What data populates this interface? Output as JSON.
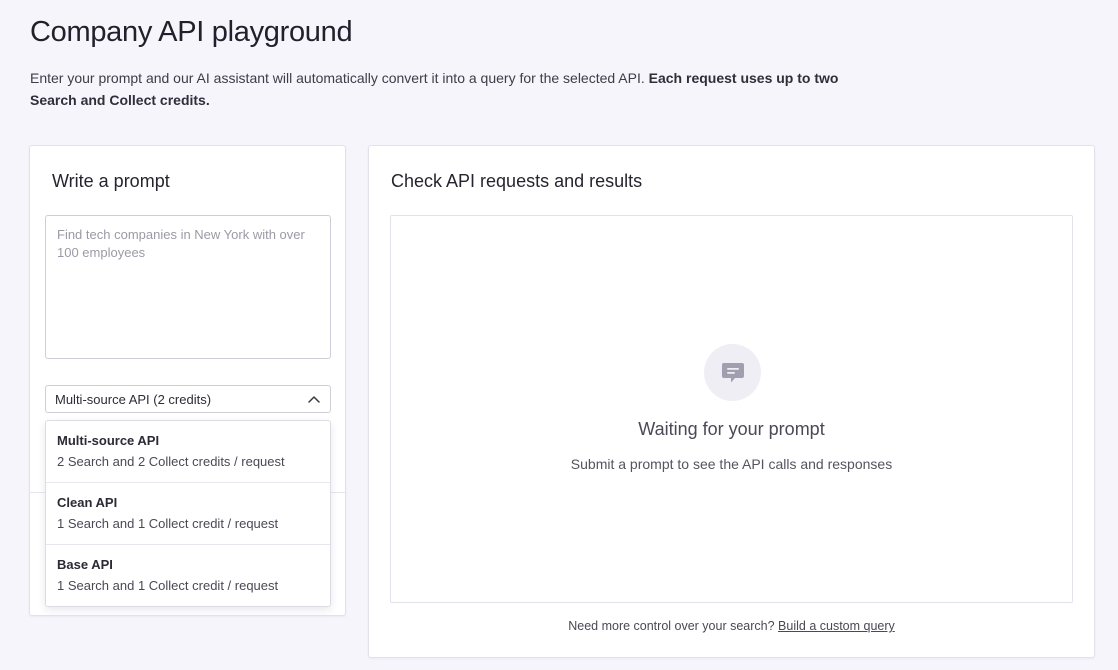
{
  "header": {
    "title": "Company API playground",
    "description": "Enter your prompt and our AI assistant will automatically convert it into a query for the selected API. ",
    "description_bold": "Each request uses up to two Search and Collect credits."
  },
  "prompt_panel": {
    "title": "Write a prompt",
    "input_placeholder": "Find tech companies in New York with over 100 employees",
    "select": {
      "selected": "Multi-source API (2 credits)",
      "options": [
        {
          "title": "Multi-source API",
          "subtitle": "2 Search and 2 Collect credits / request"
        },
        {
          "title": "Clean API",
          "subtitle": "1 Search and 1 Collect credit / request"
        },
        {
          "title": "Base API",
          "subtitle": "1 Search and 1 Collect credit / request"
        }
      ]
    }
  },
  "results_panel": {
    "title": "Check API requests and results",
    "empty_icon": "chat-bubble-icon",
    "empty_title": "Waiting for your prompt",
    "empty_subtitle": "Submit a prompt to see the API calls and responses",
    "footer_text": "Need more control over your search? ",
    "footer_link": "Build a custom query"
  },
  "colors": {
    "background": "#f6f5fc",
    "card": "#ffffff",
    "border": "#e3e2ea",
    "icon_circle": "#efeef5",
    "icon": "#9e9cad"
  }
}
